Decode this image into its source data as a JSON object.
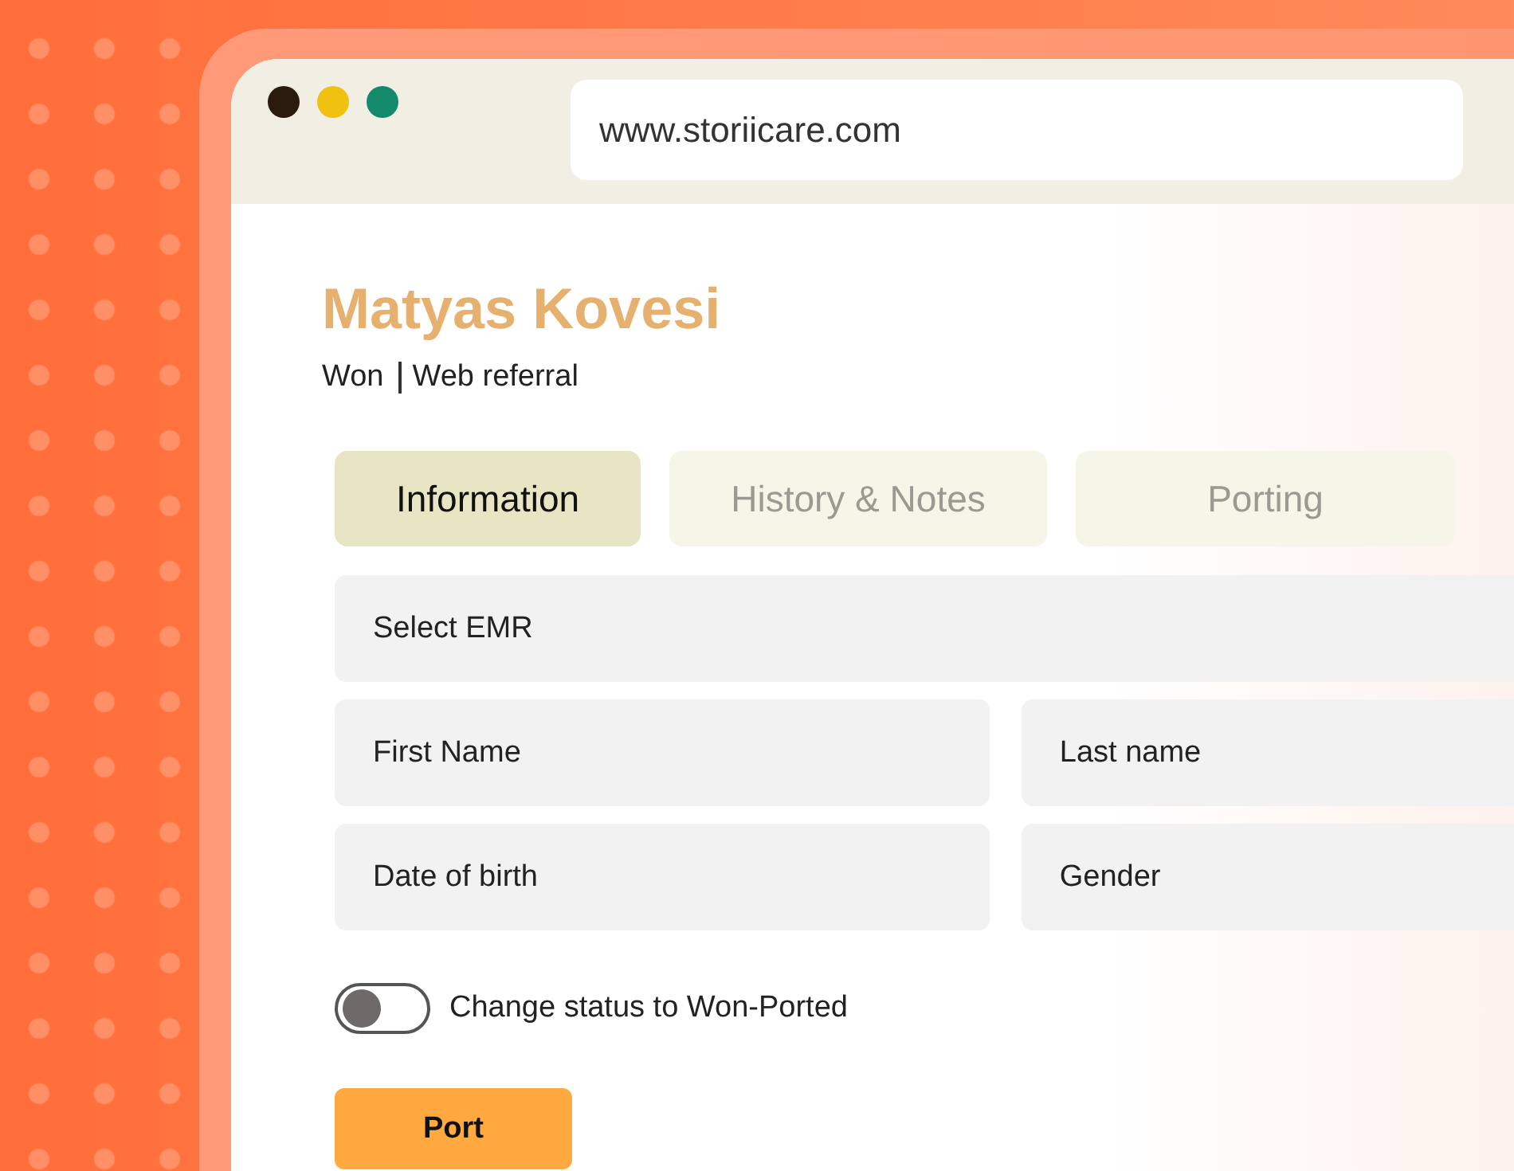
{
  "browser": {
    "url": "www.storiicare.com"
  },
  "contact": {
    "name": "Matyas Kovesi",
    "status": "Won",
    "source": "Web referral"
  },
  "tabs": [
    {
      "label": "Information",
      "selected": true
    },
    {
      "label": "History & Notes",
      "selected": false
    },
    {
      "label": "Porting",
      "selected": false
    }
  ],
  "form_rows": [
    [
      {
        "placeholder": "Select EMR"
      }
    ],
    [
      {
        "placeholder": "First Name"
      },
      {
        "placeholder": "Last name"
      }
    ],
    [
      {
        "placeholder": "Date of birth"
      },
      {
        "placeholder": "Gender"
      }
    ]
  ],
  "toggle": {
    "label": "Change status to Won-Ported",
    "on": false
  },
  "button": {
    "label": "Port"
  }
}
